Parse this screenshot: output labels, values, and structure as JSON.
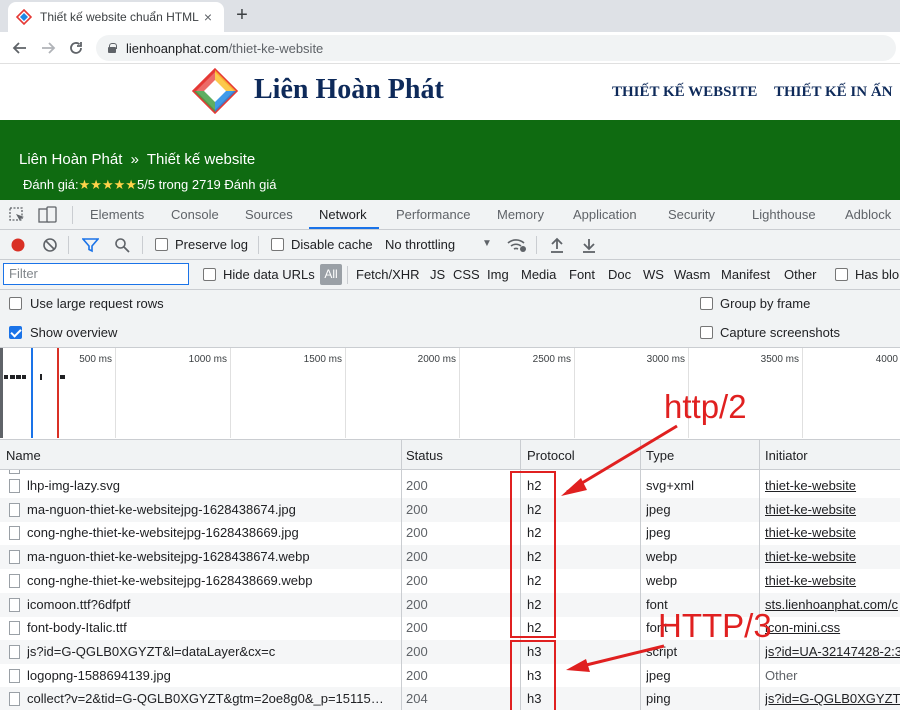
{
  "browser": {
    "tab_title": "Thiết kế website chuẩn HTML 5 -",
    "tab_close": "×",
    "new_tab": "+",
    "url_host": "lienhoanphat.com",
    "url_path": "/thiet-ke-website"
  },
  "site": {
    "logo_text": "Liên Hoàn Phát",
    "nav": [
      "THIẾT KẾ WEBSITE",
      "THIẾT KẾ IN ẤN"
    ],
    "breadcrumb_home": "Liên Hoàn Phát",
    "breadcrumb_sep": "»",
    "breadcrumb_current": "Thiết kế website",
    "rating_label": "Đánh giá:",
    "rating_stars": "★★★★★",
    "rating_text": "5/5 trong 2719 Đánh giá",
    "colors": {
      "banner": "#0f6b11",
      "brand": "#0e2a5a",
      "stars": "#ffd34a"
    }
  },
  "devtools": {
    "tabs": [
      "Elements",
      "Console",
      "Sources",
      "Network",
      "Performance",
      "Memory",
      "Application",
      "Security",
      "Lighthouse",
      "Adblock"
    ],
    "active_tab": "Network",
    "toolbar": {
      "preserve_log": "Preserve log",
      "disable_cache": "Disable cache",
      "throttling": "No throttling",
      "dropdown": "▼"
    },
    "filter": {
      "placeholder": "Filter",
      "hide_data_urls": "Hide data URLs",
      "all": "All",
      "types": [
        "Fetch/XHR",
        "JS",
        "CSS",
        "Img",
        "Media",
        "Font",
        "Doc",
        "WS",
        "Wasm",
        "Manifest",
        "Other"
      ],
      "has_blocked": "Has blo"
    },
    "options": {
      "large_rows": "Use large request rows",
      "show_overview": "Show overview",
      "group_by_frame": "Group by frame",
      "capture_screenshots": "Capture screenshots",
      "show_overview_checked": true
    },
    "overview_ticks": [
      "500 ms",
      "1000 ms",
      "1500 ms",
      "2000 ms",
      "2500 ms",
      "3000 ms",
      "3500 ms",
      "4000"
    ],
    "columns": [
      "Name",
      "Status",
      "Protocol",
      "Type",
      "Initiator"
    ],
    "rows": [
      {
        "name": "lhp-img-lazy.svg",
        "status": "200",
        "protocol": "h2",
        "type": "svg+xml",
        "initiator": "thiet-ke-website"
      },
      {
        "name": "ma-nguon-thiet-ke-websitejpg-1628438674.jpg",
        "status": "200",
        "protocol": "h2",
        "type": "jpeg",
        "initiator": "thiet-ke-website"
      },
      {
        "name": "cong-nghe-thiet-ke-websitejpg-1628438669.jpg",
        "status": "200",
        "protocol": "h2",
        "type": "jpeg",
        "initiator": "thiet-ke-website"
      },
      {
        "name": "ma-nguon-thiet-ke-websitejpg-1628438674.webp",
        "status": "200",
        "protocol": "h2",
        "type": "webp",
        "initiator": "thiet-ke-website"
      },
      {
        "name": "cong-nghe-thiet-ke-websitejpg-1628438669.webp",
        "status": "200",
        "protocol": "h2",
        "type": "webp",
        "initiator": "thiet-ke-website"
      },
      {
        "name": "icomoon.ttf?6dfptf",
        "status": "200",
        "protocol": "h2",
        "type": "font",
        "initiator": "sts.lienhoanphat.com/c"
      },
      {
        "name": "font-body-Italic.ttf",
        "status": "200",
        "protocol": "h2",
        "type": "font",
        "initiator": "icon-mini.css"
      },
      {
        "name": "js?id=G-QGLB0XGYZT&l=dataLayer&cx=c",
        "status": "200",
        "protocol": "h3",
        "type": "script",
        "initiator": "js?id=UA-32147428-2:3"
      },
      {
        "name": "logopng-1588694139.jpg",
        "status": "200",
        "protocol": "h3",
        "type": "jpeg",
        "initiator": "Other"
      },
      {
        "name": "collect?v=2&tid=G-QGLB0XGYZT&gtm=2oe8g0&_p=15115…",
        "status": "204",
        "protocol": "h3",
        "type": "ping",
        "initiator": "js?id=G-QGLB0XGYZT&"
      }
    ],
    "annotations": {
      "http2": "http/2",
      "http3": "HTTP/3",
      "color": "#e02020"
    }
  }
}
